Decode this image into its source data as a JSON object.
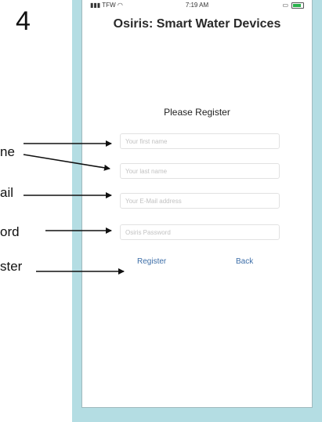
{
  "step_number": "4",
  "annotations": {
    "first_name": "ne",
    "email": "ail",
    "password": "ord",
    "register": "ster"
  },
  "status_bar": {
    "carrier": "TFW",
    "time": "7:19 AM",
    "battery_level": 0.8,
    "battery_color": "#2bb24c"
  },
  "app": {
    "title": "Osiris: Smart Water Devices",
    "form_title": "Please Register"
  },
  "fields": {
    "first_name_placeholder": "Your first name",
    "last_name_placeholder": "Your last name",
    "email_placeholder": "Your E-Mail address",
    "password_placeholder": "Osiris Password"
  },
  "buttons": {
    "register": "Register",
    "back": "Back"
  },
  "colors": {
    "frame": "#b4dde3",
    "link": "#3d6ea8"
  }
}
